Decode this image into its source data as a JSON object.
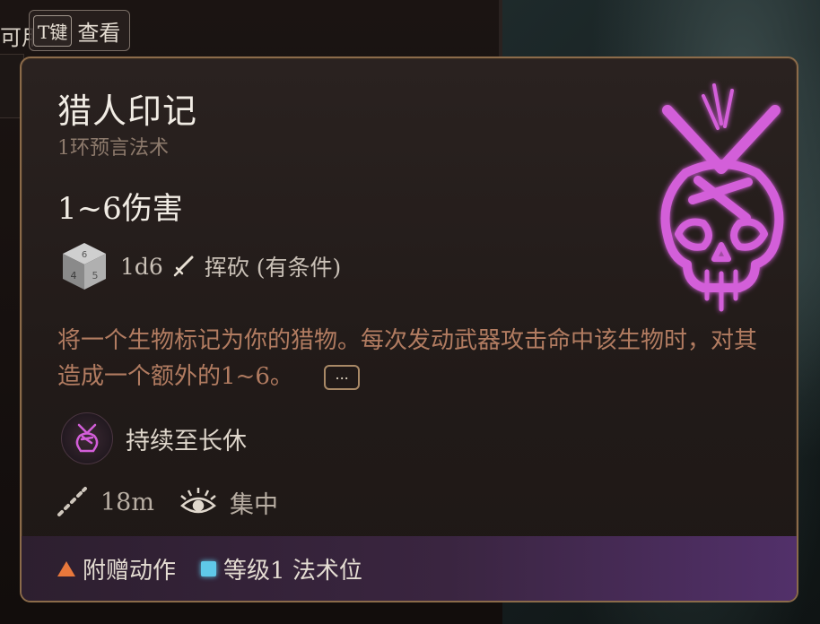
{
  "background": {
    "top_left_partial": "可用",
    "key_hint_key": "T键",
    "key_hint_label": "查看"
  },
  "tooltip": {
    "title": "猎人印记",
    "subtitle": "1环预言法术",
    "damage": "1~6伤害",
    "damage_die": "1d6",
    "damage_type": "挥砍 (有条件)",
    "description": "将一个生物标记为你的猎物。每次发动武器攻击命中该生物时，对其造成一个额外的1~6。",
    "more_label": "...",
    "duration": "持续至长休",
    "range": "18m",
    "concentration": "集中",
    "footer": {
      "action_cost": "附赠动作",
      "resource": "等级1 法术位"
    }
  },
  "colors": {
    "title_text": "#f1ece4",
    "subtitle_text": "#8d7a6c",
    "description_text": "#b27c61",
    "border_gold": "#8b6b4a",
    "skull_glow": "#d35ed9",
    "bonus_action_triangle": "#e8783c",
    "spell_slot_square": "#5fc9e8"
  },
  "icons": {
    "spell_art": "hunters-mark-skull-icon",
    "die": "d6-die-icon",
    "damage_type": "sword-slashing-icon",
    "duration": "hunters-mark-small-icon",
    "range": "range-ruler-icon",
    "concentration": "concentration-eye-icon",
    "bonus_action": "orange-triangle-icon",
    "spell_slot": "blue-square-icon"
  }
}
